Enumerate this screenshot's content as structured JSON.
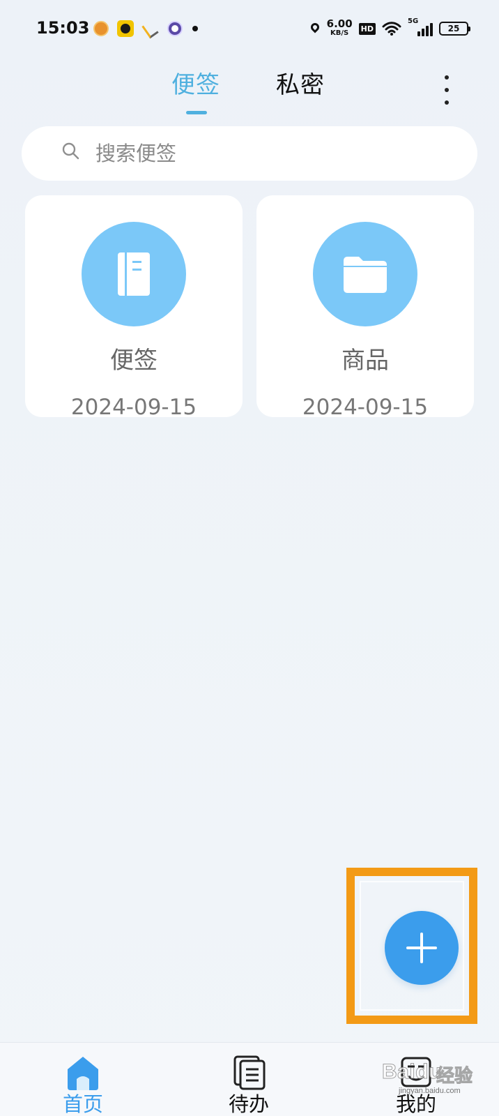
{
  "status_bar": {
    "time": "15:03",
    "speed_value": "6.00",
    "speed_unit": "KB/S",
    "hd": "HD",
    "network": "5G",
    "battery": "25"
  },
  "header": {
    "tabs": [
      {
        "label": "便签",
        "active": true
      },
      {
        "label": "私密",
        "active": false
      }
    ]
  },
  "search": {
    "placeholder": "搜索便签"
  },
  "folders": [
    {
      "title": "便签",
      "date": "2024-09-15",
      "icon": "notebook-icon"
    },
    {
      "title": "商品",
      "date": "2024-09-15",
      "icon": "folder-icon"
    }
  ],
  "fab": {
    "icon": "plus-icon"
  },
  "bottom_nav": {
    "items": [
      {
        "label": "首页",
        "icon": "home-icon",
        "active": true
      },
      {
        "label": "待办",
        "icon": "todo-icon",
        "active": false
      },
      {
        "label": "我的",
        "icon": "profile-icon",
        "active": false
      }
    ]
  },
  "colors": {
    "accent": "#4fb0df",
    "fab": "#3b9dec",
    "highlight": "#f39a16",
    "folder_circle": "#7bc8f8"
  },
  "watermark": {
    "brand": "Baidu",
    "cn": "经验",
    "url": "jingyan.baidu.com"
  }
}
